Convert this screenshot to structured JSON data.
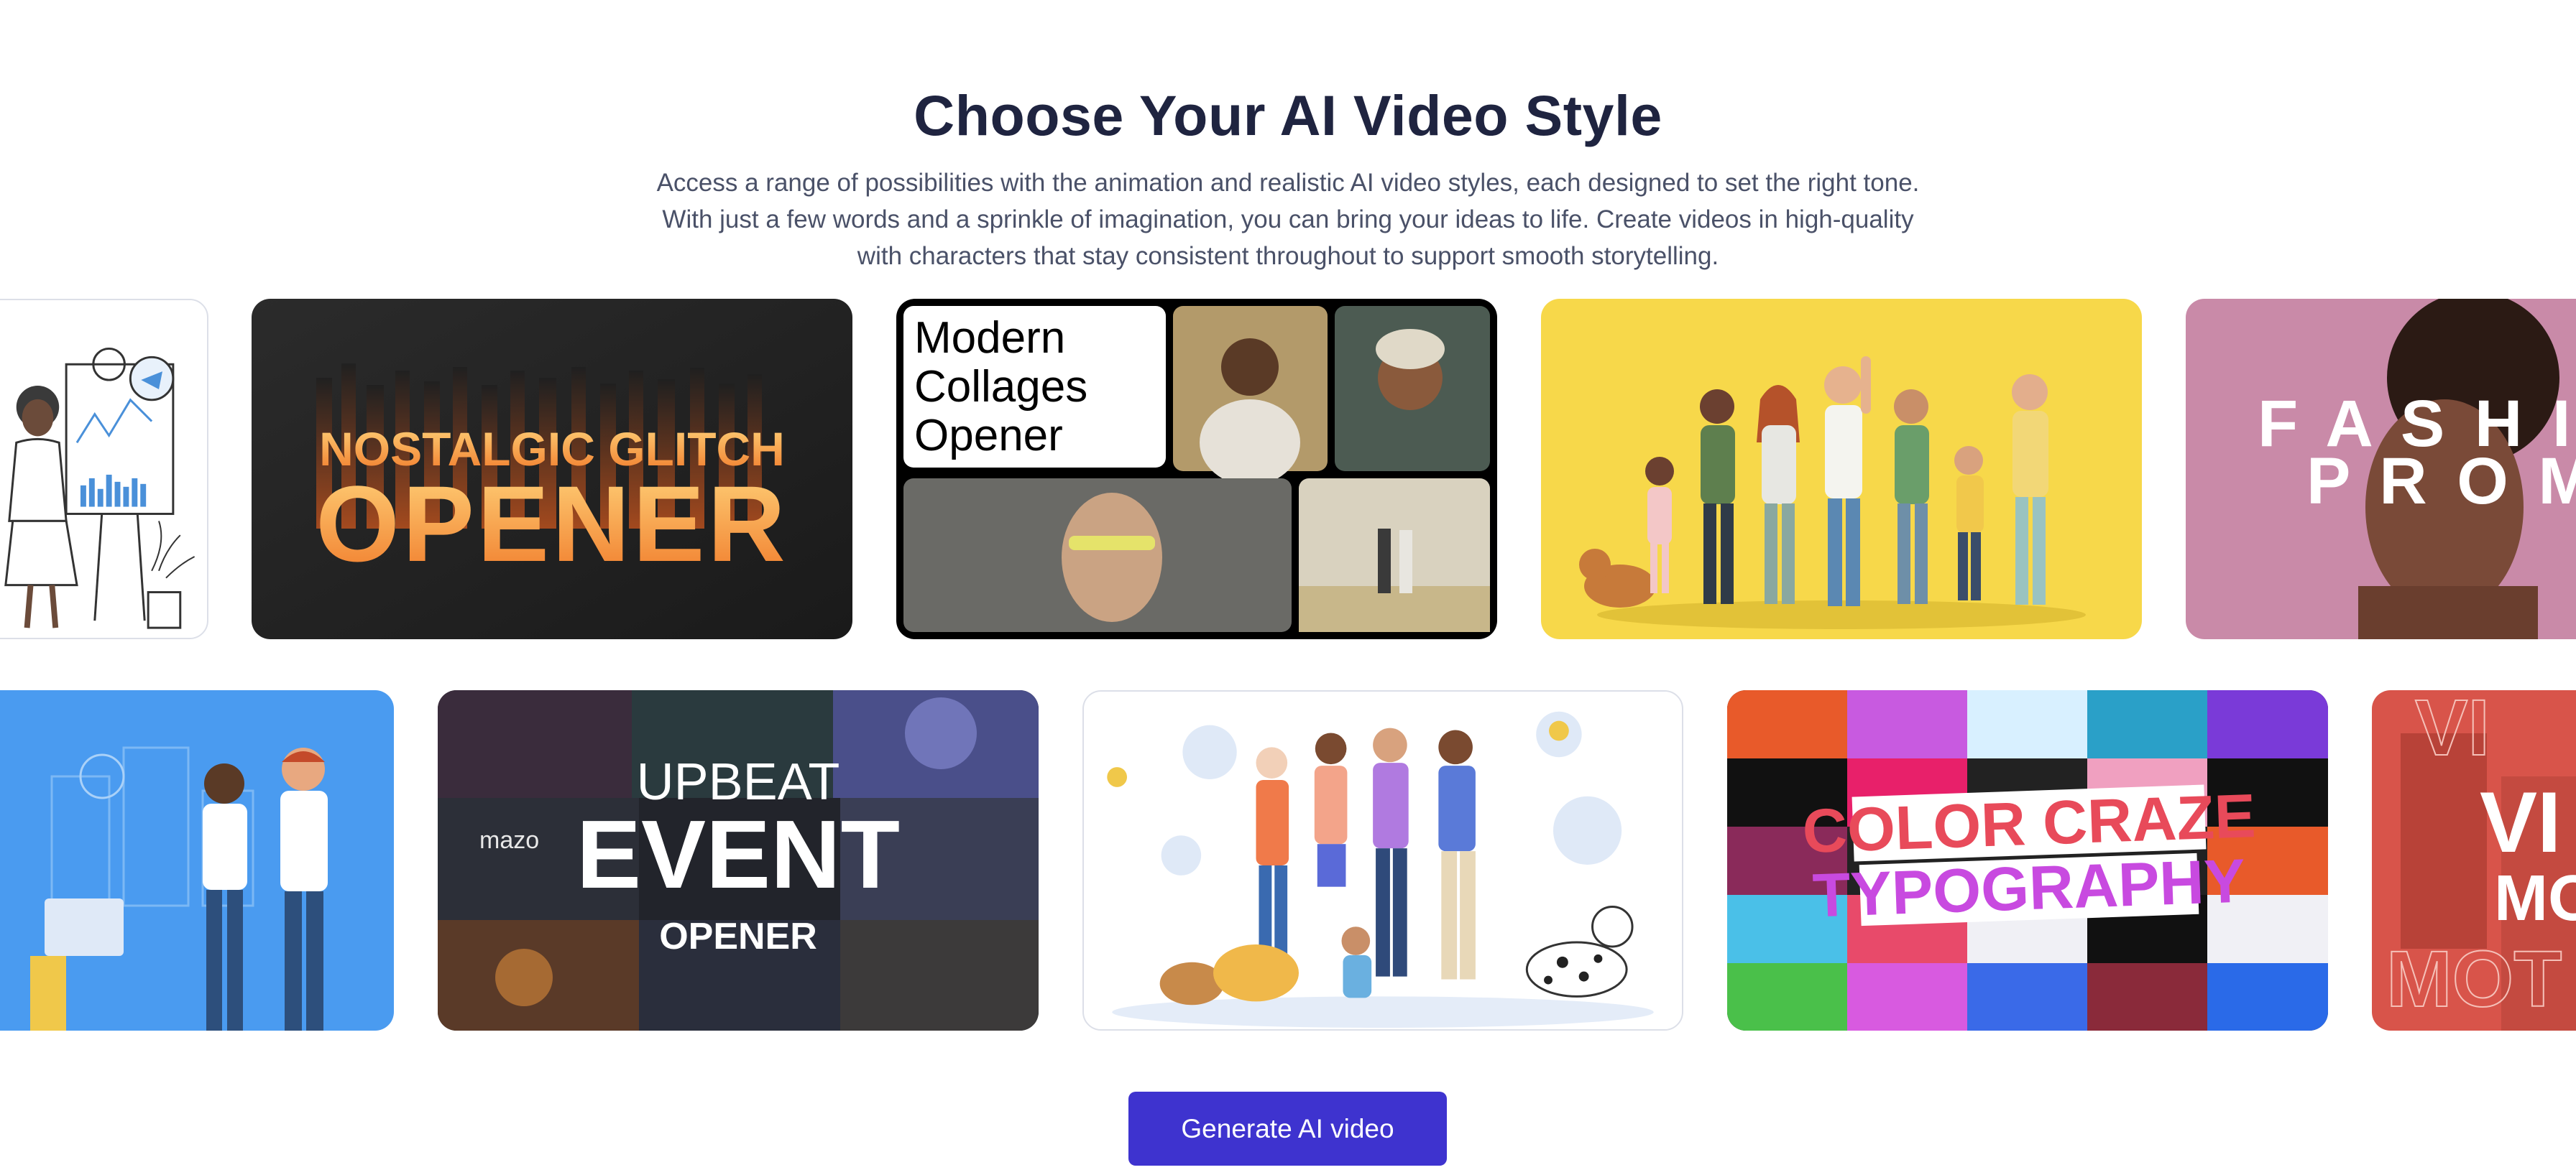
{
  "header": {
    "title": "Choose Your AI Video Style",
    "description": "Access a range of possibilities with the animation and realistic AI video styles, each designed to set the right tone. With just a few words and a sprinkle of imagination, you can bring your ideas to life. Create videos in high-quality with characters that stay consistent throughout to support smooth storytelling."
  },
  "row1": {
    "glitch": {
      "line1": "NOSTALGIC GLITCH",
      "line2": "OPENER"
    },
    "collage": {
      "line1": "Modern",
      "line2": "Collages",
      "line3": "Opener"
    },
    "fashion": {
      "line1": "F A S H I",
      "line2": "P R O M"
    }
  },
  "row2": {
    "event": {
      "line1": "UPBEAT",
      "line2": "EVENT",
      "line3": "OPENER",
      "logo": "mazo"
    },
    "typography": {
      "line1": "COLOR CRAZE",
      "line2": "TYPOGRAPHY"
    },
    "vibe": {
      "line1": "VI",
      "line2": "MO",
      "line3": "MOT"
    }
  },
  "cta": {
    "label": "Generate AI video"
  },
  "colors": {
    "accent": "#3e33cf",
    "title": "#1f2440",
    "body": "#4a5168"
  }
}
